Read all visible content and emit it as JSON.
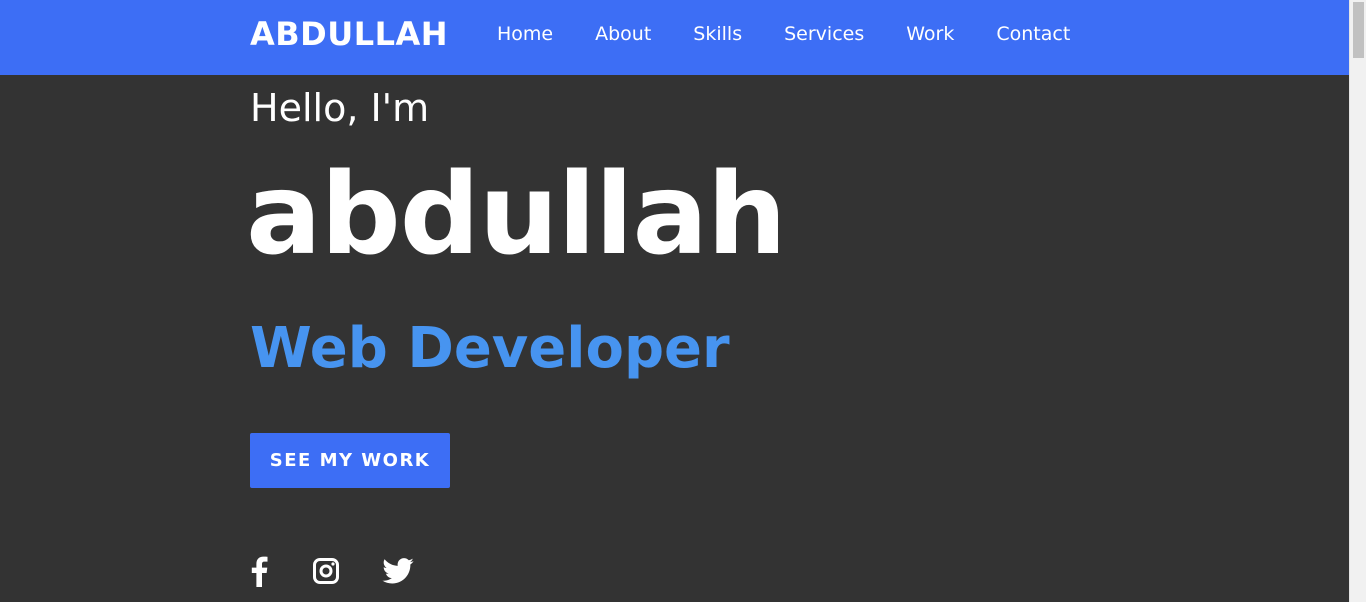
{
  "nav": {
    "brand": "ABDULLAH",
    "links": [
      "Home",
      "About",
      "Skills",
      "Services",
      "Work",
      "Contact"
    ]
  },
  "hero": {
    "greeting": "Hello, I'm",
    "name": "abdullah",
    "role": "Web Developer",
    "cta_label": "SEE MY WORK"
  },
  "social": {
    "icons": [
      "facebook-icon",
      "instagram-icon",
      "twitter-icon"
    ]
  },
  "colors": {
    "nav_background": "#3d6ef5",
    "page_background": "#333333",
    "accent_text": "#4794f0",
    "text": "#ffffff"
  }
}
